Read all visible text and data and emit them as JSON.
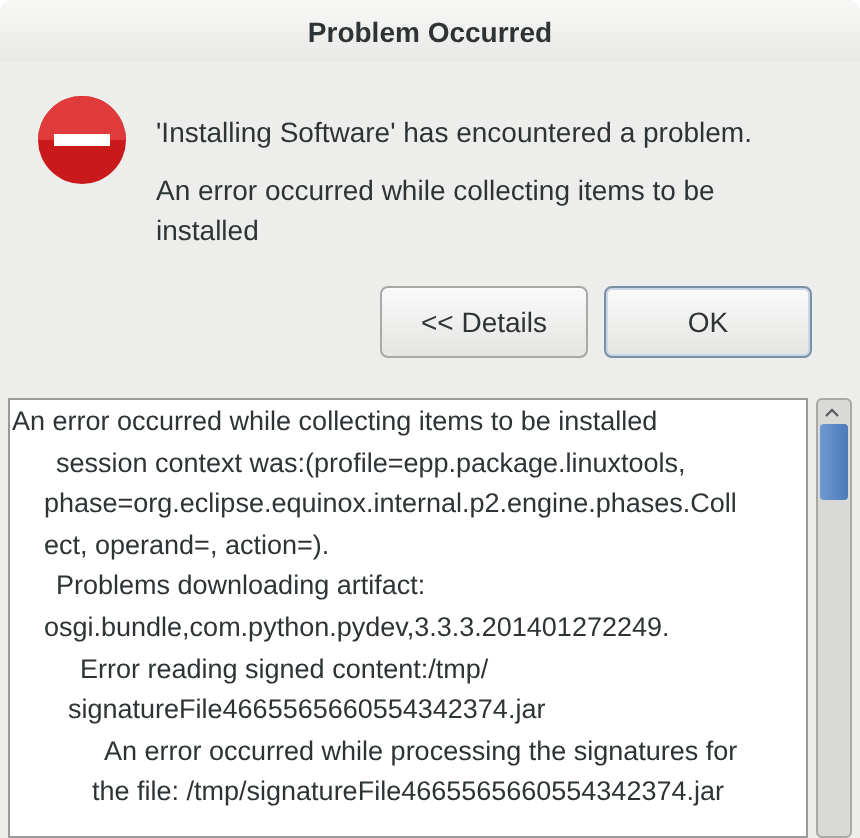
{
  "window": {
    "title": "Problem Occurred"
  },
  "message": {
    "headline": "'Installing Software' has encountered a problem.",
    "detail": "An error occurred while collecting items to be installed"
  },
  "buttons": [
    {
      "label": "<< Details",
      "default": false
    },
    {
      "label": "OK",
      "default": true
    }
  ],
  "details": [
    {
      "lines": [
        "An error occurred while collecting items to be installed"
      ],
      "children": [
        {
          "lines": [
            "session context was:(profile=epp.package.linuxtools,",
            "phase=org.eclipse.equinox.internal.p2.engine.phases.Coll",
            "ect, operand=, action=)."
          ]
        },
        {
          "lines": [
            "Problems downloading artifact:",
            "osgi.bundle,com.python.pydev,3.3.3.201401272249."
          ],
          "children": [
            {
              "lines": [
                "Error reading signed content:/tmp/",
                "signatureFile4665565660554342374.jar"
              ],
              "children": [
                {
                  "lines": [
                    "An error occurred while processing the signatures for",
                    "the file: /tmp/signatureFile4665565660554342374.jar"
                  ]
                }
              ]
            }
          ]
        }
      ]
    }
  ]
}
